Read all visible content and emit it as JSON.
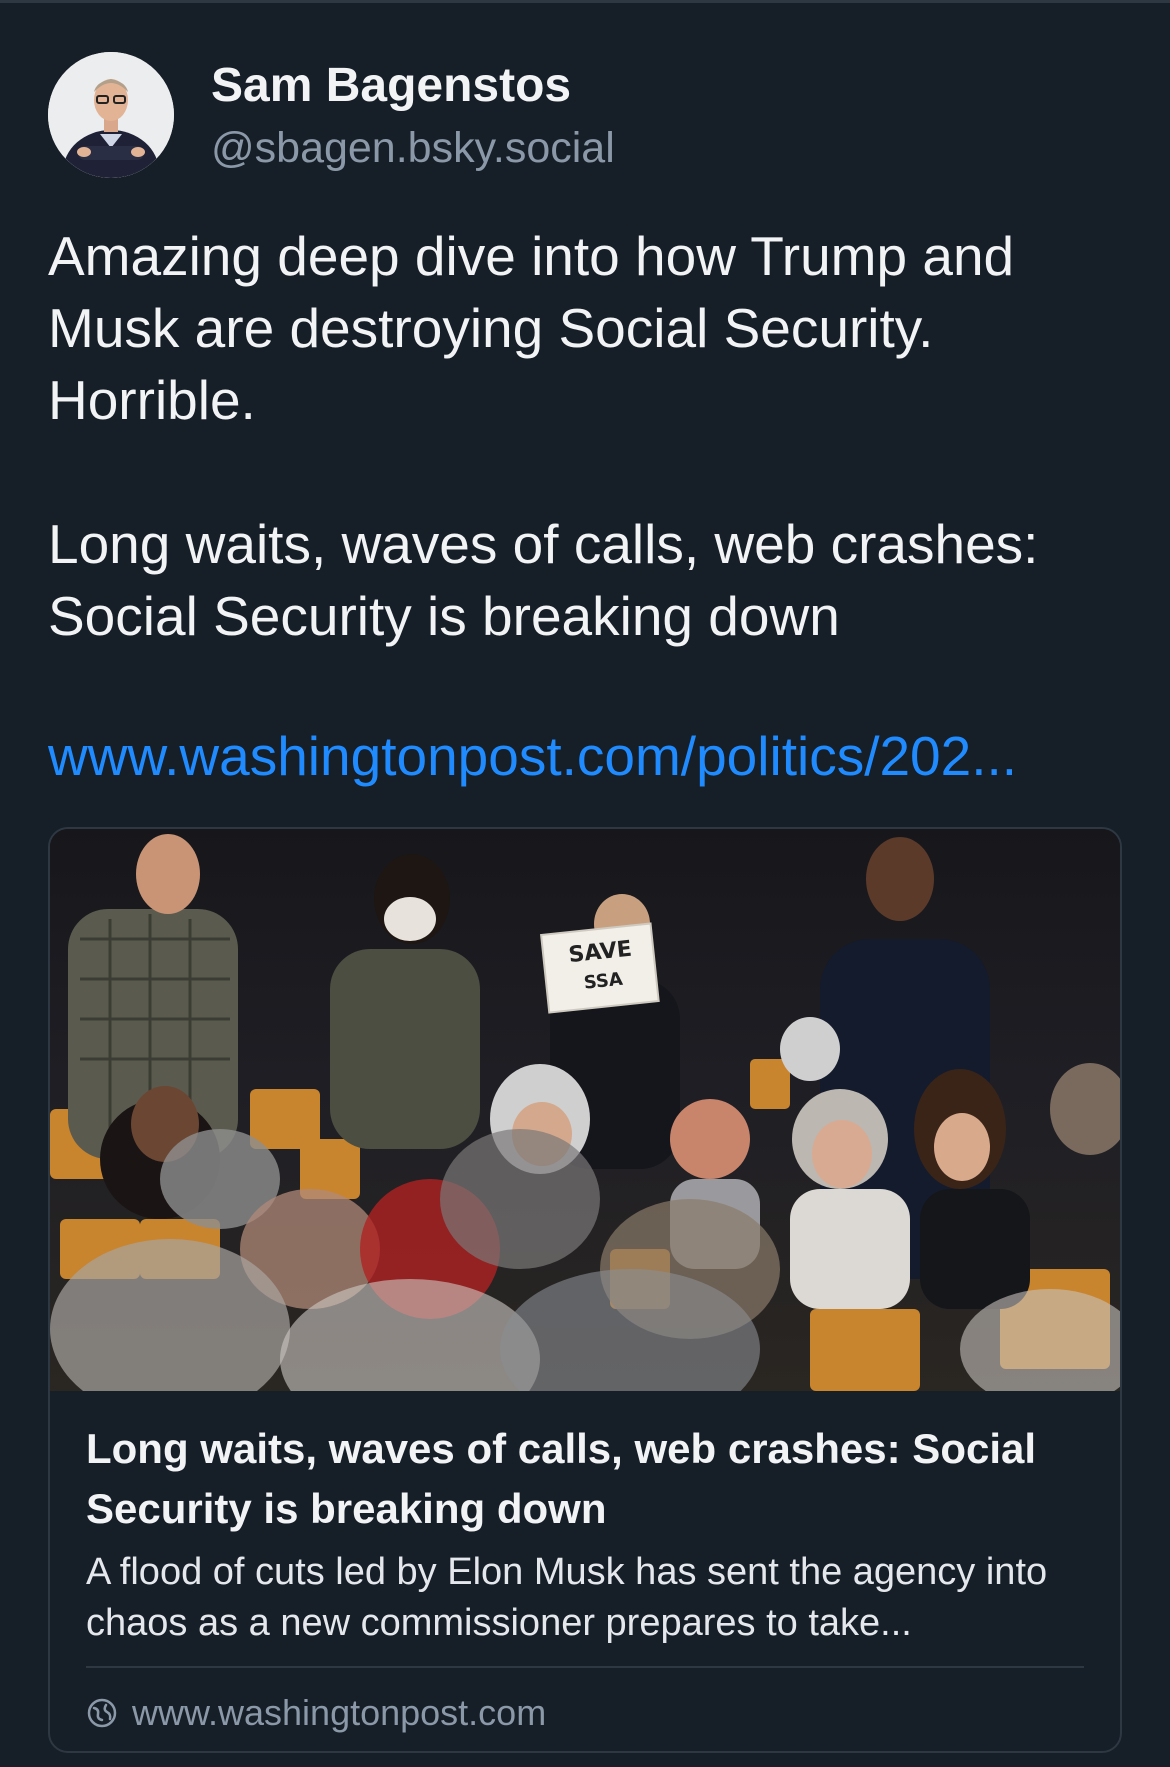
{
  "post": {
    "author": {
      "display_name": "Sam Bagenstos",
      "handle": "@sbagen.bsky.social"
    },
    "text_paragraphs": [
      "Amazing deep dive into how Trump and Musk are destroying Social Security. Horrible.",
      "Long waits, waves of calls, web crashes: Social Security is breaking down"
    ],
    "link_text": "www.washingtonpost.com/politics/202..."
  },
  "link_card": {
    "image_sign_line1": "SAVE",
    "image_sign_line2": "SSA",
    "title": "Long waits, waves of calls, web crashes: Social Security is breaking down",
    "description": "A flood of cuts led by Elon Musk has sent the agency into chaos as a new commissioner prepares to take...",
    "domain": "www.washingtonpost.com",
    "domain_icon": "globe-icon"
  },
  "colors": {
    "background": "#161e27",
    "link": "#208bfe",
    "muted_text": "#8a98a8",
    "border": "#2e3843"
  }
}
